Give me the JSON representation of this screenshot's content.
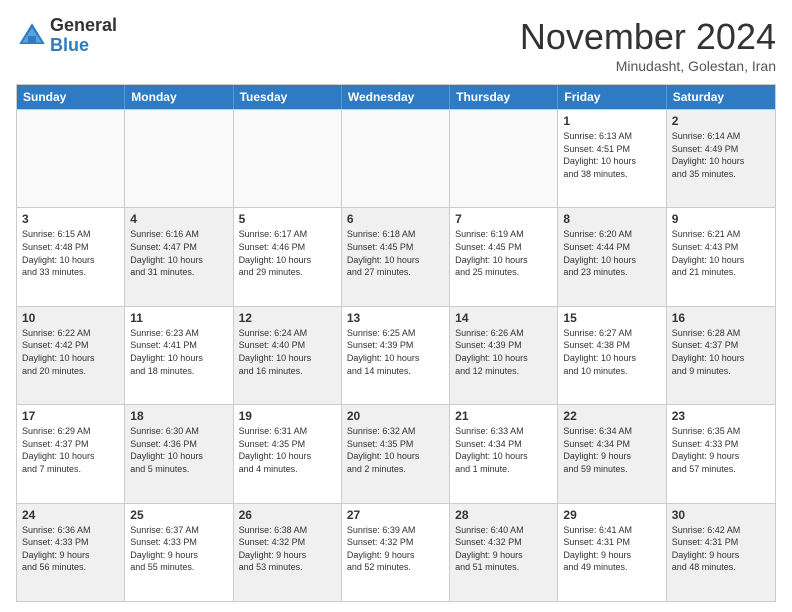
{
  "logo": {
    "general": "General",
    "blue": "Blue"
  },
  "title": "November 2024",
  "subtitle": "Minudasht, Golestan, Iran",
  "days": [
    "Sunday",
    "Monday",
    "Tuesday",
    "Wednesday",
    "Thursday",
    "Friday",
    "Saturday"
  ],
  "weeks": [
    [
      {
        "day": "",
        "info": "",
        "empty": true
      },
      {
        "day": "",
        "info": "",
        "empty": true
      },
      {
        "day": "",
        "info": "",
        "empty": true
      },
      {
        "day": "",
        "info": "",
        "empty": true
      },
      {
        "day": "",
        "info": "",
        "empty": true
      },
      {
        "day": "1",
        "info": "Sunrise: 6:13 AM\nSunset: 4:51 PM\nDaylight: 10 hours\nand 38 minutes."
      },
      {
        "day": "2",
        "info": "Sunrise: 6:14 AM\nSunset: 4:49 PM\nDaylight: 10 hours\nand 35 minutes.",
        "shaded": true
      }
    ],
    [
      {
        "day": "3",
        "info": "Sunrise: 6:15 AM\nSunset: 4:48 PM\nDaylight: 10 hours\nand 33 minutes."
      },
      {
        "day": "4",
        "info": "Sunrise: 6:16 AM\nSunset: 4:47 PM\nDaylight: 10 hours\nand 31 minutes.",
        "shaded": true
      },
      {
        "day": "5",
        "info": "Sunrise: 6:17 AM\nSunset: 4:46 PM\nDaylight: 10 hours\nand 29 minutes."
      },
      {
        "day": "6",
        "info": "Sunrise: 6:18 AM\nSunset: 4:45 PM\nDaylight: 10 hours\nand 27 minutes.",
        "shaded": true
      },
      {
        "day": "7",
        "info": "Sunrise: 6:19 AM\nSunset: 4:45 PM\nDaylight: 10 hours\nand 25 minutes."
      },
      {
        "day": "8",
        "info": "Sunrise: 6:20 AM\nSunset: 4:44 PM\nDaylight: 10 hours\nand 23 minutes.",
        "shaded": true
      },
      {
        "day": "9",
        "info": "Sunrise: 6:21 AM\nSunset: 4:43 PM\nDaylight: 10 hours\nand 21 minutes."
      }
    ],
    [
      {
        "day": "10",
        "info": "Sunrise: 6:22 AM\nSunset: 4:42 PM\nDaylight: 10 hours\nand 20 minutes.",
        "shaded": true
      },
      {
        "day": "11",
        "info": "Sunrise: 6:23 AM\nSunset: 4:41 PM\nDaylight: 10 hours\nand 18 minutes."
      },
      {
        "day": "12",
        "info": "Sunrise: 6:24 AM\nSunset: 4:40 PM\nDaylight: 10 hours\nand 16 minutes.",
        "shaded": true
      },
      {
        "day": "13",
        "info": "Sunrise: 6:25 AM\nSunset: 4:39 PM\nDaylight: 10 hours\nand 14 minutes."
      },
      {
        "day": "14",
        "info": "Sunrise: 6:26 AM\nSunset: 4:39 PM\nDaylight: 10 hours\nand 12 minutes.",
        "shaded": true
      },
      {
        "day": "15",
        "info": "Sunrise: 6:27 AM\nSunset: 4:38 PM\nDaylight: 10 hours\nand 10 minutes."
      },
      {
        "day": "16",
        "info": "Sunrise: 6:28 AM\nSunset: 4:37 PM\nDaylight: 10 hours\nand 9 minutes.",
        "shaded": true
      }
    ],
    [
      {
        "day": "17",
        "info": "Sunrise: 6:29 AM\nSunset: 4:37 PM\nDaylight: 10 hours\nand 7 minutes."
      },
      {
        "day": "18",
        "info": "Sunrise: 6:30 AM\nSunset: 4:36 PM\nDaylight: 10 hours\nand 5 minutes.",
        "shaded": true
      },
      {
        "day": "19",
        "info": "Sunrise: 6:31 AM\nSunset: 4:35 PM\nDaylight: 10 hours\nand 4 minutes."
      },
      {
        "day": "20",
        "info": "Sunrise: 6:32 AM\nSunset: 4:35 PM\nDaylight: 10 hours\nand 2 minutes.",
        "shaded": true
      },
      {
        "day": "21",
        "info": "Sunrise: 6:33 AM\nSunset: 4:34 PM\nDaylight: 10 hours\nand 1 minute."
      },
      {
        "day": "22",
        "info": "Sunrise: 6:34 AM\nSunset: 4:34 PM\nDaylight: 9 hours\nand 59 minutes.",
        "shaded": true
      },
      {
        "day": "23",
        "info": "Sunrise: 6:35 AM\nSunset: 4:33 PM\nDaylight: 9 hours\nand 57 minutes."
      }
    ],
    [
      {
        "day": "24",
        "info": "Sunrise: 6:36 AM\nSunset: 4:33 PM\nDaylight: 9 hours\nand 56 minutes.",
        "shaded": true
      },
      {
        "day": "25",
        "info": "Sunrise: 6:37 AM\nSunset: 4:33 PM\nDaylight: 9 hours\nand 55 minutes."
      },
      {
        "day": "26",
        "info": "Sunrise: 6:38 AM\nSunset: 4:32 PM\nDaylight: 9 hours\nand 53 minutes.",
        "shaded": true
      },
      {
        "day": "27",
        "info": "Sunrise: 6:39 AM\nSunset: 4:32 PM\nDaylight: 9 hours\nand 52 minutes."
      },
      {
        "day": "28",
        "info": "Sunrise: 6:40 AM\nSunset: 4:32 PM\nDaylight: 9 hours\nand 51 minutes.",
        "shaded": true
      },
      {
        "day": "29",
        "info": "Sunrise: 6:41 AM\nSunset: 4:31 PM\nDaylight: 9 hours\nand 49 minutes."
      },
      {
        "day": "30",
        "info": "Sunrise: 6:42 AM\nSunset: 4:31 PM\nDaylight: 9 hours\nand 48 minutes.",
        "shaded": true
      }
    ]
  ]
}
